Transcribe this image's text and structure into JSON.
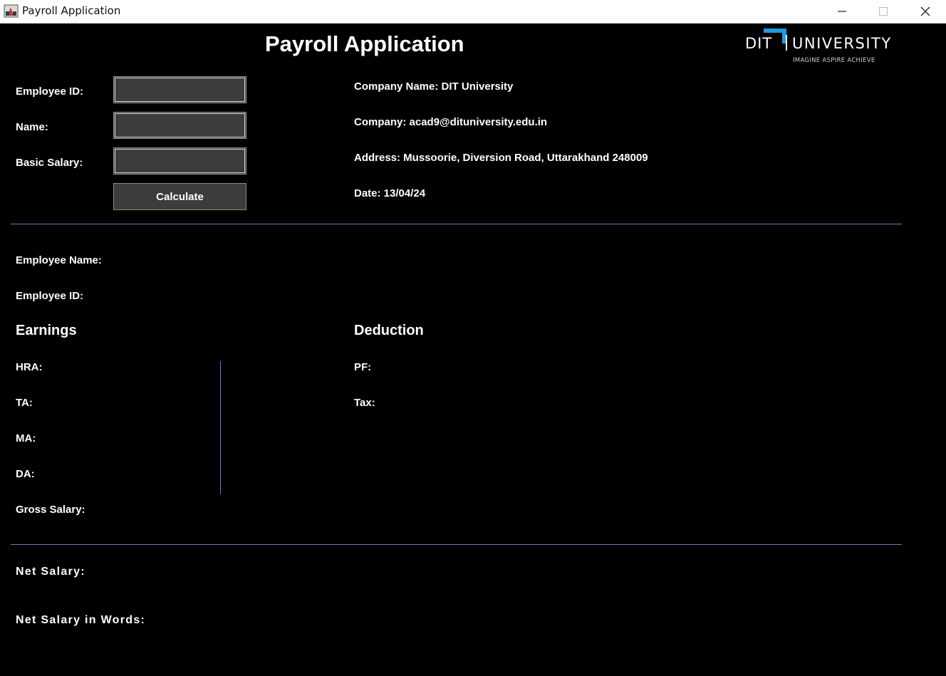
{
  "window": {
    "title": "Payroll Application"
  },
  "header": {
    "title": "Payroll Application",
    "logo": {
      "brand": "DIT UNIVERSITY",
      "tagline": "IMAGINE   ASPIRE   ACHIEVE",
      "accent_color": "#1e9be0"
    }
  },
  "form": {
    "employee_id_label": "Employee ID:",
    "employee_id_value": "",
    "name_label": "Name:",
    "name_value": "",
    "basic_salary_label": "Basic Salary:",
    "basic_salary_value": "",
    "calculate_label": "Calculate"
  },
  "company": {
    "name": "Company Name: DIT University",
    "email": "Company: acad9@dituniversity.edu.in",
    "address": "Address: Mussoorie, Diversion Road, Uttarakhand 248009",
    "date": "Date: 13/04/24"
  },
  "employee": {
    "name_label": "Employee Name:",
    "id_label": "Employee ID:"
  },
  "earnings": {
    "heading": "Earnings",
    "hra_label": "HRA:",
    "ta_label": "TA:",
    "ma_label": "MA:",
    "da_label": "DA:",
    "gross_label": "Gross Salary:"
  },
  "deduction": {
    "heading": "Deduction",
    "pf_label": "PF:",
    "tax_label": "Tax:"
  },
  "net": {
    "salary_label": "Net Salary:",
    "words_label": "Net Salary in Words:"
  },
  "colors": {
    "background": "#000000",
    "input_background": "#3c3c3c",
    "divider": "#6f7ab8",
    "text": "#ffffff"
  }
}
